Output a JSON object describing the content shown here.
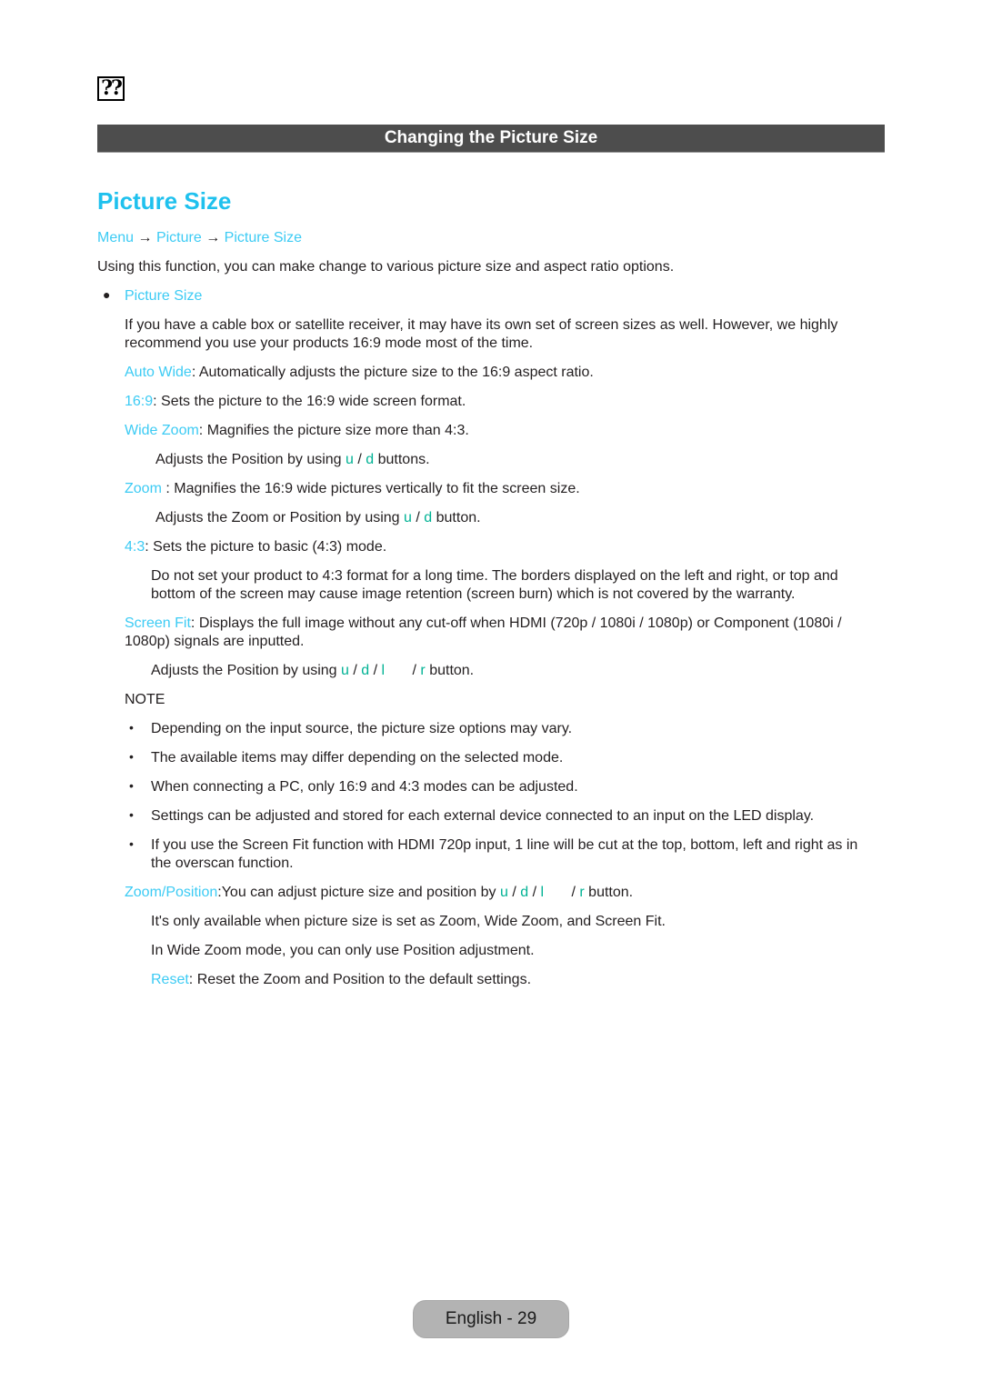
{
  "header": {
    "icon": "missing-glyph-icon",
    "icon_text": "??",
    "section_title": "Changing the Picture Size"
  },
  "main": {
    "title": "Picture Size",
    "breadcrumb": [
      "Menu",
      "→",
      "Picture",
      "→",
      "Picture Size"
    ],
    "intro": "Using this function, you can make change to various picture size and aspect ratio options.",
    "bullet_label": "Picture Size",
    "bullet_desc_line1": "If you have a cable box or satellite receiver, it may have its own set of screen sizes as well. However, we highly",
    "bullet_desc_line2": "recommend you use your products 16:9 mode most of the time.",
    "options": {
      "auto_wide": {
        "label": "Auto Wide",
        "text": ": Automatically adjusts the picture size to the 16:9 aspect ratio."
      },
      "ratio_169": {
        "label": "16:9",
        "text": ": Sets the picture to the 16:9 wide screen format."
      },
      "wide_zoom": {
        "label": "Wide Zoom",
        "text": ": Magnifies the picture size more than 4:3."
      },
      "wide_zoom_sub": {
        "pre": "Adjusts the Position by using ",
        "k1": "u",
        "sep": " / ",
        "k2": "d",
        "post": " buttons."
      },
      "zoom": {
        "label": "Zoom",
        "text": " : Magnifies the 16:9 wide pictures vertically to fit the screen size."
      },
      "zoom_sub": {
        "pre": "Adjusts the Zoom or Position by using ",
        "k1": "u",
        "sep": " / ",
        "k2": "d",
        "post": " button."
      },
      "ratio_43": {
        "label": "4:3",
        "text": ": Sets the picture to basic (4:3) mode."
      },
      "ratio_43_warn1": "Do not set your product to 4:3 format for a long time. The borders displayed on the left and right, or top and",
      "ratio_43_warn2": "bottom of the screen may cause image retention (screen burn) which is not covered by the warranty.",
      "screen_fit": {
        "label": "Screen Fit",
        "text1": ": Displays the full image without any cut-off when HDMI (720p / 1080i / 1080p) or Component (1080i /",
        "text2": "1080p) signals are inputted."
      },
      "screen_fit_sub": {
        "pre": "Adjusts the Position by using ",
        "k1": "u",
        "k2": "d",
        "k3": "l",
        "k4": "r",
        "sep": " / ",
        "post": " button."
      }
    },
    "note_heading": "NOTE",
    "notes": [
      "Depending on the input source, the picture size options may vary.",
      "The available items may differ depending on the selected mode.",
      "When connecting a PC, only 16:9 and 4:3 modes can be adjusted.",
      "Settings can be adjusted and stored for each external device connected to an input on the LED display.",
      "If you use the Screen Fit function with HDMI 720p input, 1 line will be cut at the top, bottom, left and right as in",
      "the overscan function."
    ],
    "zoom_position": {
      "label": "Zoom/Position",
      "pre": ":You can adjust picture size and position by ",
      "k1": "u",
      "k2": "d",
      "k3": "l",
      "k4": "r",
      "sep": " / ",
      "post": " button.",
      "info1": "It's only available when picture size is set as Zoom, Wide Zoom, and Screen Fit.",
      "info2": "In Wide Zoom mode, you can only use Position adjustment.",
      "reset_label": "Reset",
      "reset_text": ": Reset the Zoom and Position to the default settings."
    }
  },
  "footer": {
    "page_label": "English - 29"
  },
  "colors": {
    "accent": "#1fc1ee",
    "link": "#3ccbf4",
    "key": "#00b294",
    "bar": "#4d4d4d"
  }
}
